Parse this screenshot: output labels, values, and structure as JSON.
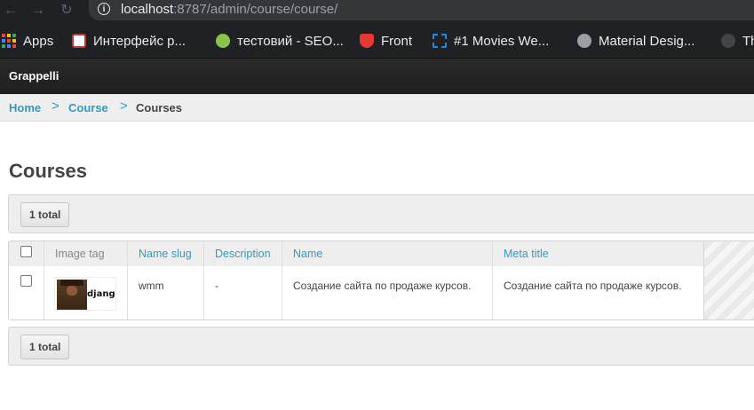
{
  "browser": {
    "url_host": "localhost",
    "url_path": ":8787/admin/course/course/",
    "bookmarks": [
      {
        "label": "Apps",
        "icon": "apps-grid-icon",
        "color": "#ea4335"
      },
      {
        "label": "Интерфейс р...",
        "icon": "bookmark-favicon",
        "color": "#c0392b"
      },
      {
        "label": "тестовий - SEO...",
        "icon": "seo-favicon",
        "color": "#8bc34a"
      },
      {
        "label": "Front",
        "icon": "heart-favicon",
        "color": "#e53935"
      },
      {
        "label": "#1 Movies We...",
        "icon": "movies-favicon",
        "color": "#1e88e5"
      },
      {
        "label": "Material Desig...",
        "icon": "globe-favicon",
        "color": "#9aa0a6"
      },
      {
        "label": "Th",
        "icon": "github-favicon",
        "color": "#444444"
      }
    ]
  },
  "header": {
    "brand": "Grappelli"
  },
  "breadcrumbs": {
    "home": "Home",
    "app": "Course",
    "separator": ">",
    "current": "Courses"
  },
  "page": {
    "title": "Courses"
  },
  "toolbar": {
    "total_label": "1 total"
  },
  "table": {
    "columns": [
      "Image tag",
      "Name slug",
      "Description",
      "Name",
      "Meta title"
    ],
    "rows": [
      {
        "image_alt_text": "django",
        "name_slug": "wmm",
        "description": "-",
        "name": "Создание сайта по продаже курсов.",
        "meta_title": "Создание сайта по продаже курсов."
      }
    ]
  },
  "colors": {
    "accent": "#309bbf",
    "header_bg": "#222222"
  }
}
